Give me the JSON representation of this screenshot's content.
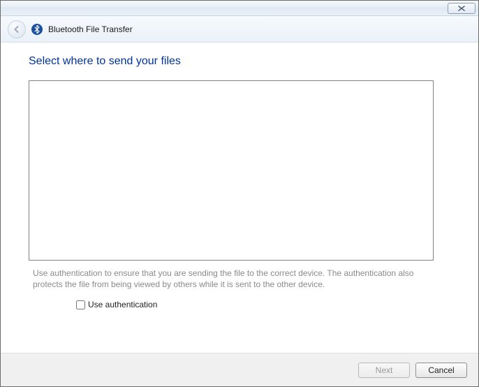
{
  "window_title": "Bluetooth File Transfer",
  "heading": "Select where to send your files",
  "description": "Use authentication to ensure that you are sending the file to the correct device. The authentication also protects the file from being viewed by others while it is sent to the other device.",
  "checkbox": {
    "label": "Use authentication",
    "checked": false
  },
  "buttons": {
    "next": "Next",
    "cancel": "Cancel"
  },
  "next_enabled": false
}
